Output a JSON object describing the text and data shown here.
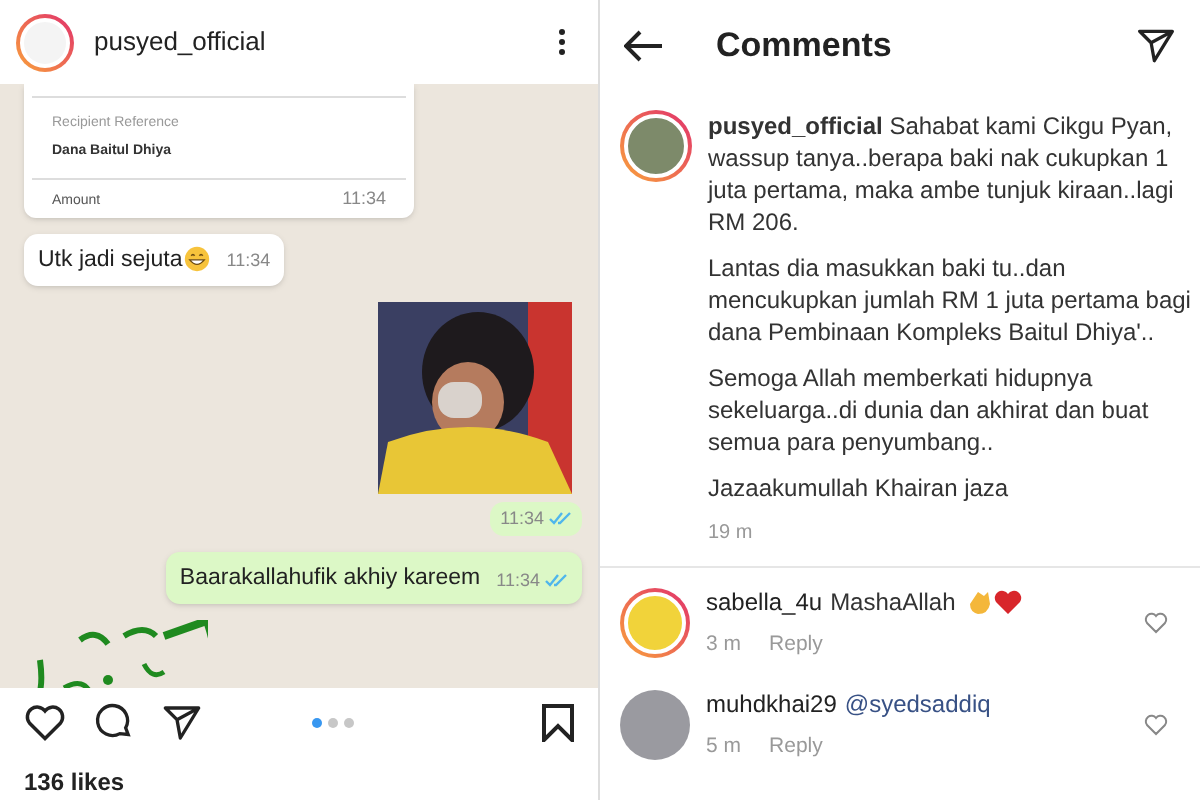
{
  "post": {
    "username": "pusyed_official",
    "chat": {
      "receipt": {
        "label": "Recipient Reference",
        "value": "Dana Baitul Dhiya",
        "cut_label": "Amount",
        "time": "11:34"
      },
      "messages": [
        {
          "kind": "text",
          "outgoing": false,
          "text": "Utk jadi sejuta",
          "emoji": true,
          "time": "11:34"
        },
        {
          "kind": "sticker",
          "outgoing": true,
          "time": "11:34",
          "read": true
        },
        {
          "kind": "text",
          "outgoing": true,
          "text": "Baarakallahufik akhiy kareem",
          "time": "11:34",
          "read": true
        },
        {
          "kind": "calligraphy",
          "outgoing": false
        }
      ]
    },
    "carousel": [
      {
        "selected": true
      },
      {
        "selected": false
      },
      {
        "selected": false
      }
    ],
    "likes": "136 likes"
  },
  "comments_screen": {
    "title": "Comments",
    "caption": {
      "paragraphs": [
        "**pusyed_official** Sahabat kami Cikgu Pyan, wassup tanya..berapa baki nak cukupkan 1 juta pertama, maka ambe tunjuk kiraan..lagi RM 206.",
        "Lantas dia masukkan baki tu..dan mencukupkan jumlah RM 1 juta pertama bagi dana Pembinaan Kompleks Baitul Dhiya'..",
        "Semoga Allah memberkati hidupnya sekeluarga..di dunia dan akhirat dan buat semua para penyumbang..",
        "Jazaakumullah Khairan jaza"
      ],
      "time": "19 m"
    },
    "comments": [
      {
        "username": "sabella_4u",
        "text": "MashaAllah",
        "emoji": true,
        "time": "3 m",
        "reply": "Reply",
        "avatar_ring": true
      },
      {
        "username": "muhdkhai29",
        "mention": "@syedsaddiq",
        "time": "5 m",
        "reply": "Reply",
        "avatar_ring": false
      }
    ]
  }
}
